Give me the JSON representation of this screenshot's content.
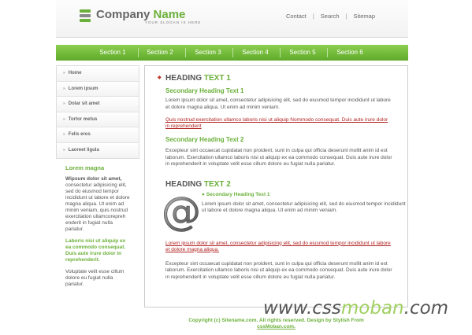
{
  "header": {
    "logo_title_a": "Company ",
    "logo_title_b": "Name",
    "slogan": "YOUR SLOGAN IS HERE",
    "links": [
      "Contact",
      "Search",
      "Sitemap"
    ]
  },
  "nav": {
    "items": [
      "Section 1",
      "Section 2",
      "Section 3",
      "Section 4",
      "Section 5",
      "Section 6"
    ]
  },
  "sidebar": {
    "menu": [
      "Home",
      "Lorem ipsum",
      "Dolar sit amet",
      "Tortor metus",
      "Felis eros",
      "Laoreet ligula"
    ],
    "heading": "Lorem magna",
    "bold_text": "Wipsum dolor sit amet,",
    "text1": " consectetur adipisicing elit, sed do eiusmod tempor incididunt ut labore et dolore magna aliqua. Ut enim ad minim veniam, quis nostrud exercitation ullamcorepreh enderit in fugiat nulla pariatur.",
    "green_text": "Laboris nisi ut aliquip ex ea commodo consequat. Duis aute irure dolor in reprehenderit.",
    "text2": "Voluptate velit esse cillum dolore eu fugiat nulla pariatur."
  },
  "content": {
    "heading1_a": "HEADING ",
    "heading1_b": "TEXT 1",
    "sec_heading1": "Secondary Heading Text 1",
    "para1": "Lorem ipsum dolor sit amet, consectetur adipisicing elit, sed do eiusmod tempor incididunt ut labore et dolore magna aliqua. Ut enim ad minim veniam.",
    "link1": "Quis nostrud exercitation ullamco laboris nisi ut aliquip Nommodo consequat. Duis aute irure dolor in reprehenderit",
    "sec_heading2": "Secondary Heading Text 2",
    "para2": "Excepteur sint occaecat cupidatat non proident, sunt in culpa qui officia deserunt mollit anim id est laborum. Exercitation ullamco laboris nisi ut aliquip ex ea commodo consequat. Duis aute irure dolor in reprehenderit in voluptate velit esse cillum dolore eu fugiat nulla pariatur.",
    "heading2_a": "HEADING ",
    "heading2_b": "TEXT 2",
    "sub_heading": "Secondary Heading Text 1",
    "para3": "Lorem ipsum dolor sit amet, consectetur adipisicing elit, sed do eiusmod tempor incididunt ut labore et dolore magna aliqua. Ut enim ad minim veniam.",
    "link2": "Lorem ipsum dolor sit amet, consectetur adipisicing elit, sed do eiusmod tempor incididunt ut labore et dolore magna aliqua.",
    "para4": "Excepteur sint occaecat cupidatat non proident, sunt in culpa qui officia deserunt mollit anim id est laborum. Exercitation ullamco laboris nisi ut aliquip ex ea commodo consequat. Duis aute irure dolor in reprehenderit in voluptate velit esse cillum dolore eu fugiat nulla pariatur."
  },
  "footer": {
    "copyright": "Copyright (c) Sitename.com. All rights reserved. Design by Stylish From",
    "link": "cssMoban.com."
  },
  "watermark": {
    "part1": "www.css",
    "part2": "moban",
    "part3": ".com"
  },
  "colors": {
    "accent": "#6bb03a",
    "link": "#b01e1e",
    "text": "#555555"
  },
  "icons": [
    "logo-stack-icon",
    "at-sign-icon",
    "bullet-icon"
  ]
}
